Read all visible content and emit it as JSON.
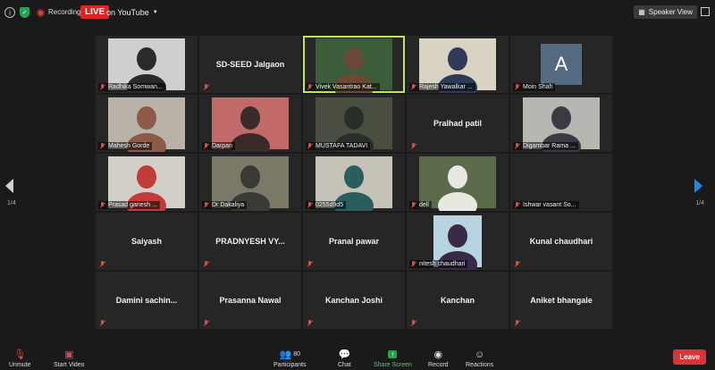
{
  "top": {
    "recording": "Recording",
    "live": "LIVE",
    "stream": "on YouTube",
    "view": "Speaker View"
  },
  "pages": {
    "left": "1/4",
    "right": "1/4"
  },
  "participants": [
    {
      "name": "Radhika Somwan...",
      "type": "video",
      "bg": "#cfcfcf",
      "fg": "#2a2a2a"
    },
    {
      "name": "SD-SEED Jalgaon",
      "type": "nameonly"
    },
    {
      "name": "Vivek Vasantrao Kat...",
      "type": "video",
      "bg": "#3b5d3a",
      "fg": "#6a4a36",
      "active": true
    },
    {
      "name": "Rajesh Yawalkar ...",
      "type": "video",
      "bg": "#d9d3c4",
      "fg": "#2e3a58"
    },
    {
      "name": "Moin Shah",
      "type": "avatar",
      "initial": "A"
    },
    {
      "name": "Mahesh Gorde",
      "type": "video",
      "bg": "#b8b2a8",
      "fg": "#8c5a46"
    },
    {
      "name": "Darpan",
      "type": "video",
      "bg": "#c26a6a",
      "fg": "#3a2a2a"
    },
    {
      "name": "MUSTAFA TADAVI",
      "type": "video",
      "bg": "#4a4e40",
      "fg": "#2a2e2a"
    },
    {
      "name": "Pralhad patil",
      "type": "nameonly"
    },
    {
      "name": "Digambar Rama ...",
      "type": "video",
      "bg": "#b8b6b0",
      "fg": "#3a3a44"
    },
    {
      "name": "Prasad ganesh ...",
      "type": "video",
      "bg": "#d2cfc8",
      "fg": "#c23c3c"
    },
    {
      "name": "Dr Dakaliya",
      "type": "video",
      "bg": "#7b7868",
      "fg": "#3a3a36"
    },
    {
      "name": "0255d9d5",
      "type": "video",
      "bg": "#c6c2b8",
      "fg": "#2a5e5e"
    },
    {
      "name": "dell",
      "type": "video",
      "bg": "#5a6a4a",
      "fg": "#e8e8e0"
    },
    {
      "name": "Ishwar vasant So...",
      "type": "blank"
    },
    {
      "name": "Saiyash",
      "type": "nameonly"
    },
    {
      "name": "PRADNYESH VY...",
      "type": "nameonly"
    },
    {
      "name": "Pranal pawar",
      "type": "nameonly"
    },
    {
      "name": "nitesh chaudhari",
      "type": "photo",
      "bg": "#b8d4e0",
      "fg": "#3a2a4a"
    },
    {
      "name": "Kunal chaudhari",
      "type": "nameonly"
    },
    {
      "name": "Damini sachin...",
      "type": "nameonly"
    },
    {
      "name": "Prasanna Nawal",
      "type": "nameonly"
    },
    {
      "name": "Kanchan Joshi",
      "type": "nameonly"
    },
    {
      "name": "Kanchan",
      "type": "nameonly"
    },
    {
      "name": "Aniket bhangale",
      "type": "nameonly"
    }
  ],
  "toolbar": {
    "unmute": "Unmute",
    "start_video": "Start Video",
    "participants": "Participants",
    "participants_count": "80",
    "chat": "Chat",
    "share": "Share Screen",
    "record": "Record",
    "reactions": "Reactions",
    "leave": "Leave"
  }
}
